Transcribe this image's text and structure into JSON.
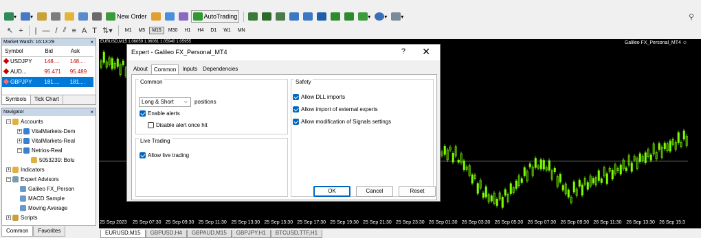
{
  "toolbar1": {
    "new_order": "New Order",
    "autotrading": "AutoTrading"
  },
  "timeframes": [
    "M1",
    "M5",
    "M15",
    "M30",
    "H1",
    "H4",
    "D1",
    "W1",
    "MN"
  ],
  "active_timeframe": "M15",
  "market_watch": {
    "title": "Market Watch: 16:13:29",
    "headers": [
      "Symbol",
      "Bid",
      "Ask"
    ],
    "rows": [
      {
        "symbol": "USDJPY",
        "bid": "148....",
        "ask": "148....",
        "color": "#c00000"
      },
      {
        "symbol": "AUD...",
        "bid": "95.471",
        "ask": "95.489",
        "color": "#c00000"
      },
      {
        "symbol": "GBPJPY",
        "bid": "181....",
        "ask": "181....",
        "color": "#ffffff"
      }
    ],
    "tabs": [
      "Symbols",
      "Tick Chart"
    ]
  },
  "navigator": {
    "title": "Navigator",
    "items": {
      "accounts": "Accounts",
      "acc1": "VitalMarkets-Dem",
      "acc2": "VitalMarkets-Real",
      "acc3": "Netrios-Real",
      "acc3_login": "5053239: Bolu",
      "indicators": "Indicators",
      "experts": "Expert Advisors",
      "ea1": "Galileo FX_Person",
      "ea2": "MACD Sample",
      "ea3": "Moving Average",
      "scripts": "Scripts"
    },
    "tabs": [
      "Common",
      "Favorites"
    ]
  },
  "chart": {
    "title": "EURUSD,M15  1.06059 1.06061 1.05940 1.05955",
    "ea_label": "Galileo FX_Personal_MT4 ☺",
    "times": [
      "25 Sep 2023",
      "25 Sep 07:30",
      "25 Sep 09:30",
      "25 Sep 11:30",
      "25 Sep 13:30",
      "25 Sep 15:30",
      "25 Sep 17:30",
      "25 Sep 19:30",
      "25 Sep 21:30",
      "25 Sep 23:30",
      "26 Sep 01:30",
      "26 Sep 03:30",
      "26 Sep 05:30",
      "26 Sep 07:30",
      "26 Sep 09:30",
      "26 Sep 11:30",
      "26 Sep 13:30",
      "26 Sep 15:3"
    ],
    "tabs": [
      "EURUSD,M15",
      "GBPUSD,H4",
      "GBPAUD,M15",
      "GBPJPY,H1",
      "BTCUSD,TTF,H1"
    ],
    "active_tab": "EURUSD,M15"
  },
  "dialog": {
    "title": "Expert - Galileo FX_Personal_MT4",
    "help": "?",
    "close": "✕",
    "tabs": [
      "About",
      "Common",
      "Inputs",
      "Dependencies"
    ],
    "active_tab": "Common",
    "common_group": "Common",
    "positions_value": "Long & Short",
    "positions_label": "positions",
    "enable_alerts": "Enable alerts",
    "enable_alerts_checked": true,
    "disable_alert": "Disable alert once hit",
    "disable_alert_checked": false,
    "live_group": "Live Trading",
    "allow_live": "Allow live trading",
    "allow_live_checked": true,
    "safety_group": "Safety",
    "allow_dll": "Allow DLL imports",
    "allow_dll_checked": true,
    "allow_import": "Allow import of external experts",
    "allow_import_checked": true,
    "allow_signals": "Allow modification of Signals settings",
    "allow_signals_checked": true,
    "ok": "OK",
    "cancel": "Cancel",
    "reset": "Reset"
  },
  "colors": {
    "accent": "#0067c0",
    "bull": "#7cfc00",
    "chart_bg": "#000000"
  }
}
